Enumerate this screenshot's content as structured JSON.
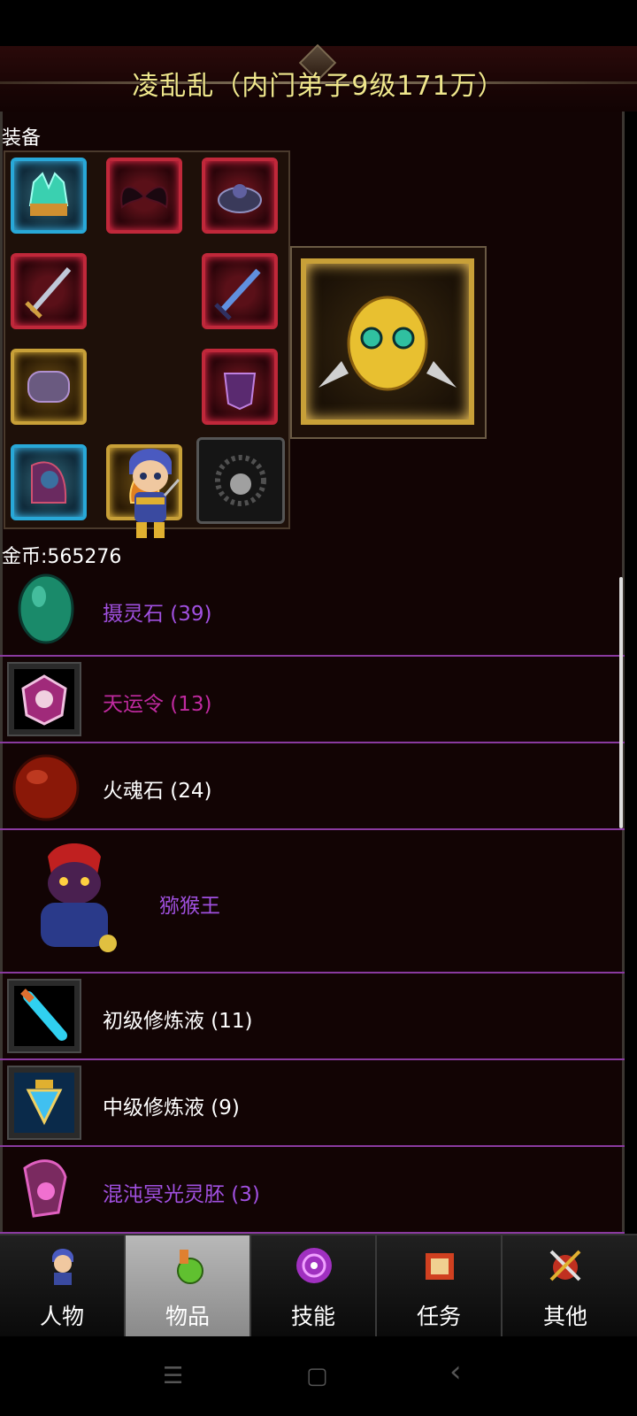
{
  "header": {
    "title": "凌乱乱（内门弟子9级171万）"
  },
  "equipment": {
    "label": "装备",
    "slots": [
      "helmet",
      "wings",
      "shoulder",
      "sword",
      "sword2",
      "bracer",
      "armor",
      "cloak",
      "boots",
      "necklace"
    ]
  },
  "gold": {
    "label": "金币:565276"
  },
  "inventory": [
    {
      "name": "摄灵石 (39)",
      "color": "#a050e0"
    },
    {
      "name": "天运令 (13)",
      "color": "#c02aa0"
    },
    {
      "name": "火魂石 (24)",
      "color": "#ffffff"
    },
    {
      "name": "猕猴王",
      "color": "#a050e0"
    },
    {
      "name": "初级修炼液 (11)",
      "color": "#ffffff"
    },
    {
      "name": "中级修炼液 (9)",
      "color": "#ffffff"
    },
    {
      "name": "混沌冥光灵胚 (3)",
      "color": "#a050e0"
    }
  ],
  "tabs": [
    {
      "label": "人物",
      "active": false
    },
    {
      "label": "物品",
      "active": true
    },
    {
      "label": "技能",
      "active": false
    },
    {
      "label": "任务",
      "active": false
    },
    {
      "label": "其他",
      "active": false
    }
  ],
  "nav": {
    "menu": "☰",
    "home": "▢",
    "back": "‹"
  }
}
